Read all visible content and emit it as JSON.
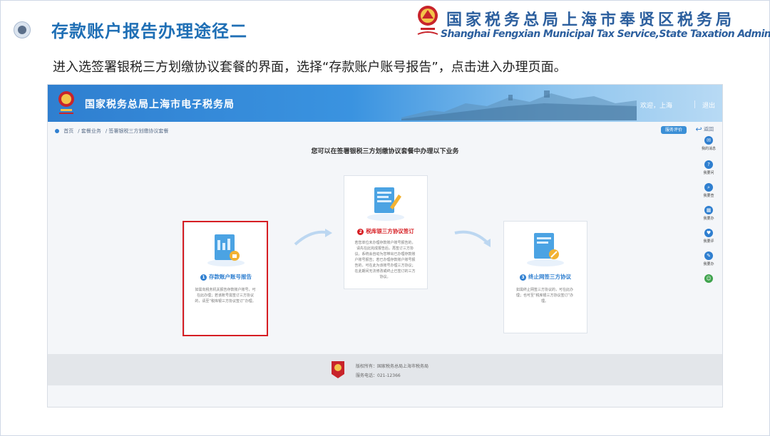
{
  "slide": {
    "title": "存款账户报告办理途径二",
    "org_name_cn": "国家税务总局上海市奉贤区税务局",
    "org_name_en": "Shanghai Fengxian Municipal Tax Service,State Taxation  Administration",
    "instruction": "进入选签署银税三方划缴协议套餐的界面，选择“存款账户账号报告”，点击进入办理页面。"
  },
  "portal": {
    "title": "国家税务总局上海市电子税务局",
    "welcome": "欢迎，上海",
    "logout": "退出",
    "breadcrumb": [
      "首页",
      "套餐业务",
      "签署银税三方划缴协议套餐"
    ],
    "feedback_label": "服务评价",
    "back_label": "返回",
    "heading": "您可以在签署银税三方划缴协议套餐中办理以下业务",
    "cards": [
      {
        "number": "1",
        "title": "存款账户账号报告",
        "desc": "如需向税务机关报告存款账户账号，可在此办理；若该账号需签订三方协议的，请至“税库银三方协议签订”办理。"
      },
      {
        "number": "2",
        "title": "税库银三方协议签订",
        "desc": "若您单位未办理存款账户账号报告的，请先在此完成报告后，再签订三方协议。系统会自动为您带出已办理存款账户账号报告；若已办理存款账户账号报告的，可在此为该账号办理三方协议；在此期间无法修改或终止已签订的三方协议。"
      },
      {
        "number": "3",
        "title": "终止网签三方协议",
        "desc": "如需终止网签三方协议的，可在此办理；也可至“税库银三方协议签订”办理。"
      }
    ],
    "rail": [
      {
        "label": "我的消息",
        "icon": "message-icon"
      },
      {
        "label": "我要问",
        "icon": "question-icon"
      },
      {
        "label": "我要查",
        "icon": "search-icon"
      },
      {
        "label": "我要办",
        "icon": "calendar-icon"
      },
      {
        "label": "我要评",
        "icon": "heart-icon"
      },
      {
        "label": "我要办",
        "icon": "edit-icon"
      },
      {
        "label": "",
        "icon": "assistant-icon"
      }
    ],
    "footer": {
      "copyright": "版权所有：国家税务总局上海市税务局",
      "phone": "服务电话：021-12366"
    }
  },
  "colors": {
    "title_blue": "#1f6fb5",
    "highlight_red": "#d61e23",
    "portal_blue": "#2f7fd0",
    "card1_title": "#2f7fd0",
    "card2_title": "#d61e23",
    "card3_title": "#2f7fd0"
  }
}
